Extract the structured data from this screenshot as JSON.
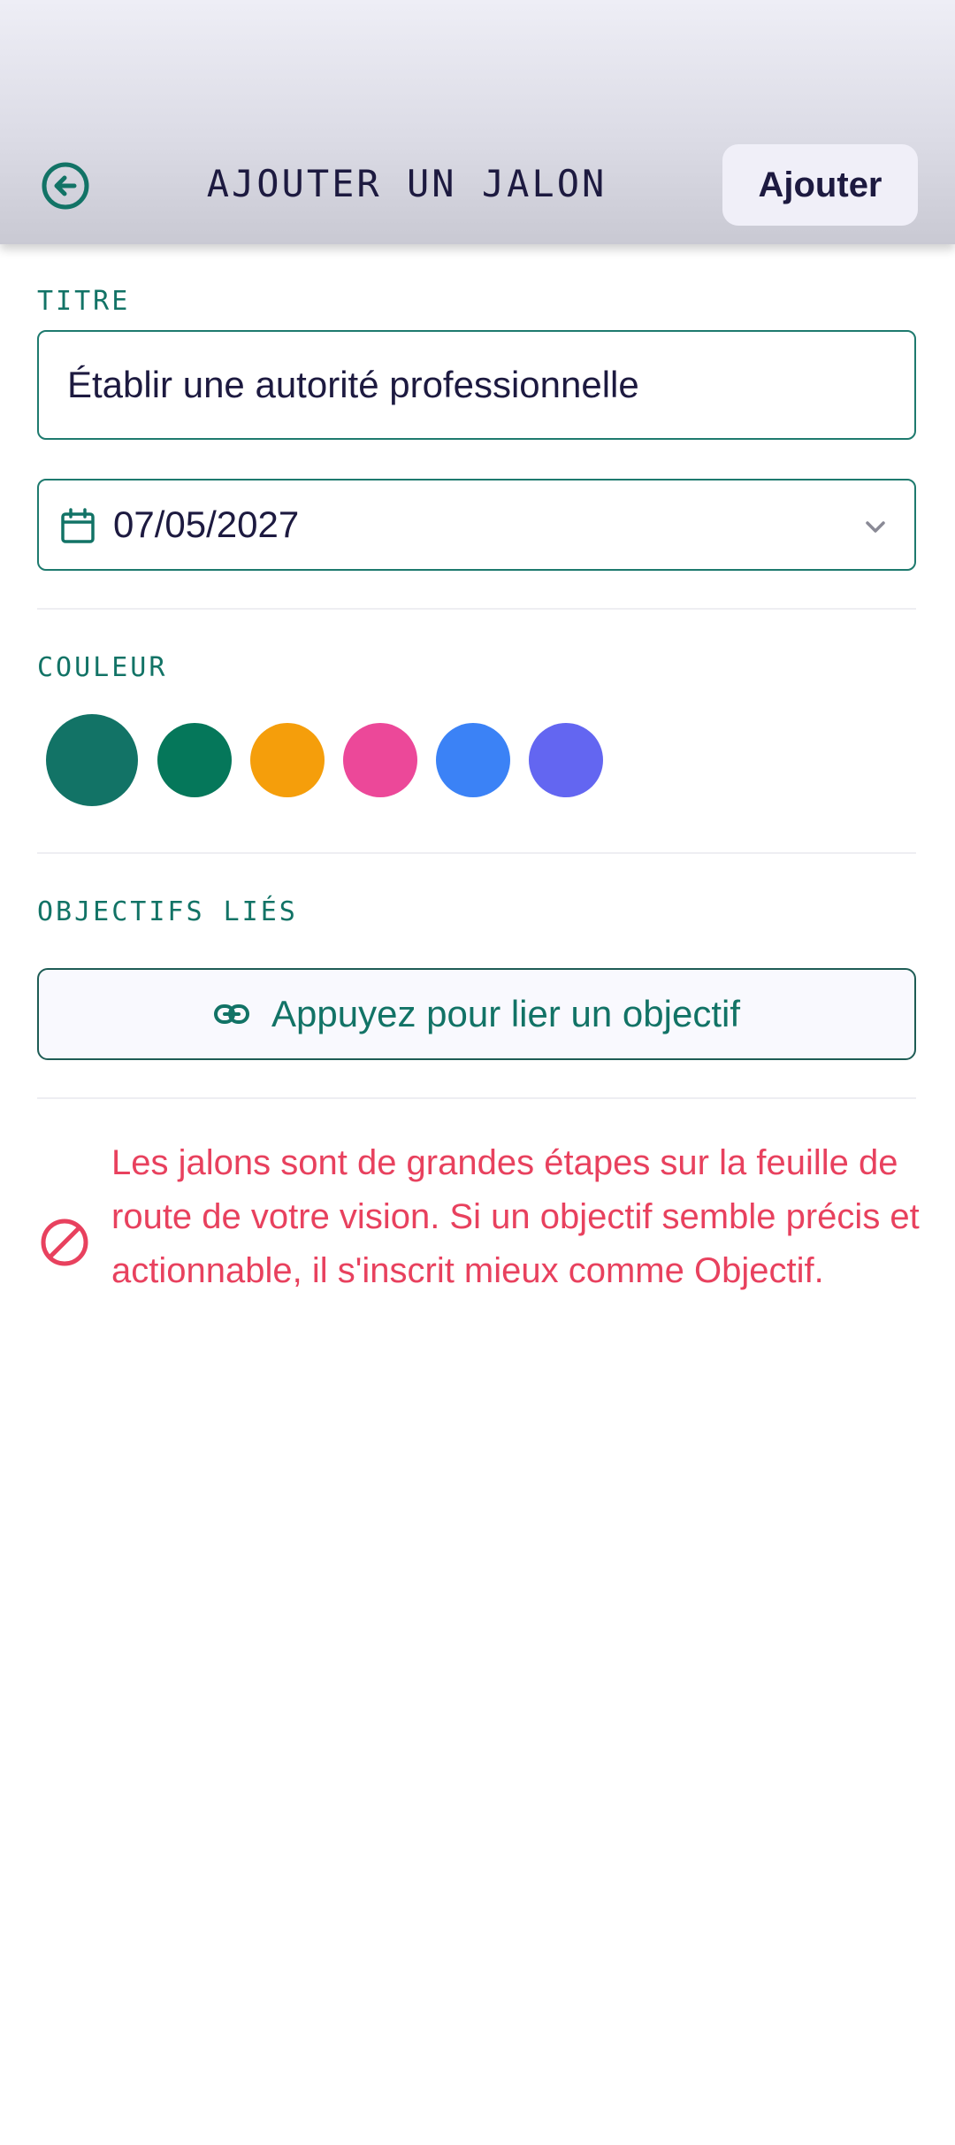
{
  "header": {
    "title": "AJOUTER UN JALON",
    "add_label": "Ajouter",
    "back_icon": "arrow-left-circle-icon"
  },
  "form": {
    "title_label": "TITRE",
    "title_value": "Établir une autorité professionnelle",
    "date_value": "07/05/2027",
    "date_icon": "calendar-icon",
    "color_label": "COULEUR",
    "colors": [
      {
        "hex": "#127366",
        "selected": true
      },
      {
        "hex": "#05775a",
        "selected": false
      },
      {
        "hex": "#f59e0b",
        "selected": false
      },
      {
        "hex": "#ec4899",
        "selected": false
      },
      {
        "hex": "#3b82f6",
        "selected": false
      },
      {
        "hex": "#6366f1",
        "selected": false
      }
    ],
    "linked_label": "OBJECTIFS LIÉS",
    "link_button_label": "Appuyez pour lier un objectif",
    "link_icon": "link-icon"
  },
  "warning": {
    "icon": "prohibited-icon",
    "text": "Les jalons sont de grandes étapes sur la feuille de route de votre vision. Si un objectif semble précis et actionnable, il s'inscrit mieux comme Objectif."
  },
  "colors": {
    "accent": "#127366",
    "text_dark": "#1d1a40",
    "warning": "#e8415e"
  }
}
